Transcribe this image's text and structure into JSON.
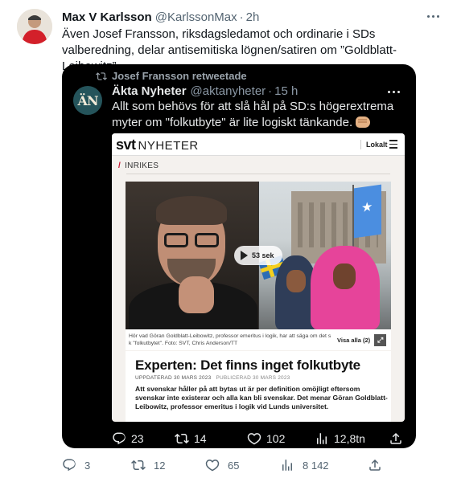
{
  "tweet": {
    "author_name": "Max V Karlsson",
    "author_handle": "@KarlssonMax",
    "separator": "·",
    "time": "2h",
    "text": "Även Josef Fransson, riksdagsledamot och ordinarie i SDs valberedning, delar antisemitiska lögnen/satiren om ”Goldblatt-Leibowitz”.",
    "actions": {
      "replies": "3",
      "retweets": "12",
      "likes": "65",
      "views": "8 142"
    }
  },
  "retweet": {
    "retweeted_by": "Josef Fransson retweetade",
    "author_name": "Äkta Nyheter",
    "author_handle": "@aktanyheter",
    "separator": "·",
    "time": "15 h",
    "avatar_text": "ÄN",
    "text": "Allt som behövs för att slå hål på SD:s högerextrema myter om \"folkutbyte\" är lite logiskt tänkande.",
    "actions": {
      "replies": "23",
      "retweets": "14",
      "likes": "102",
      "views": "12,8tn"
    }
  },
  "svt": {
    "logo": "svt",
    "logo_suffix": "NYHETER",
    "lokalt": "Lokalt",
    "section": "INRIKES",
    "video_duration": "53 sek",
    "caption": "Hör vad Göran Goldblatt-Leibowitz, professor emeritus i logik, har att säga om det s k \"folkutbytet\". Foto: SVT, Chris Anderson/TT",
    "visa_alla": "Visa alla (2)",
    "headline": "Experten: Det finns inget folkutbyte",
    "updated": "UPPDATERAD 30 MARS 2023",
    "published": "PUBLICERAD 30 MARS 2023",
    "lead": "Att svenskar håller på att bytas ut är per definition omöjligt eftersom svenskar inte existerar och alla kan bli svenskar. Det menar Göran Goldblatt-Leibowitz, professor emeritus i logik vid Lunds universitet."
  },
  "icons": {
    "reply": "reply-icon",
    "retweet": "retweet-icon",
    "like": "heart-icon",
    "views": "views-icon",
    "share": "share-icon",
    "more": "more-icon"
  },
  "colors": {
    "text_primary": "#0f1419",
    "text_secondary": "#536471",
    "card_bg": "#000000",
    "svt_red": "#c8102e"
  }
}
